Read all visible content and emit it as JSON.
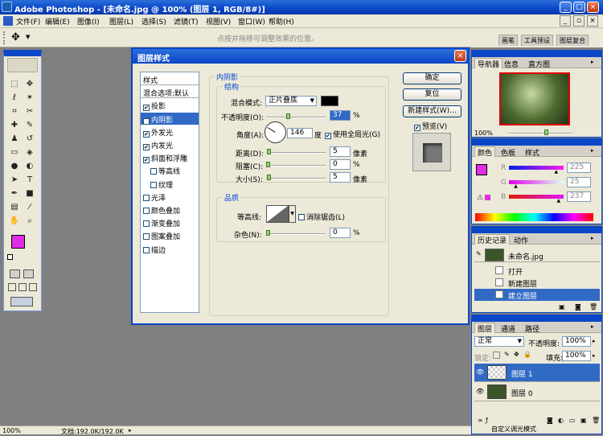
{
  "app": {
    "title": "Adobe Photoshop - [未命名.jpg @ 100% (图层 1, RGB/8#)]"
  },
  "menu": [
    "文件(F)",
    "编辑(E)",
    "图像(I)",
    "图层(L)",
    "选择(S)",
    "滤镜(T)",
    "视图(V)",
    "窗口(W)",
    "帮助(H)"
  ],
  "options": {
    "hint": "点按并拖移可调整效果的位置。"
  },
  "wells": [
    "画笔",
    "工具预设",
    "图层复合"
  ],
  "toolbox": {
    "icons": [
      "marquee-icon",
      "move-icon",
      "lasso-icon",
      "magic-wand-icon",
      "crop-icon",
      "slice-icon",
      "healing-icon",
      "brush-icon",
      "stamp-icon",
      "history-brush-icon",
      "eraser-icon",
      "bucket-icon",
      "blur-icon",
      "dodge-icon",
      "path-select-icon",
      "type-icon",
      "pen-icon",
      "shape-icon",
      "notes-icon",
      "eyedropper-icon",
      "hand-icon",
      "zoom-icon"
    ],
    "fg_color": "#e12ce6",
    "bg_color": "#ffffff"
  },
  "dialog": {
    "title": "图层样式",
    "styles": [
      {
        "label": "样式",
        "checkbox": false,
        "checked": false
      },
      {
        "label": "混合选项:默认",
        "checkbox": false,
        "checked": false
      },
      {
        "label": "投影",
        "checkbox": true,
        "checked": true
      },
      {
        "label": "内阴影",
        "checkbox": true,
        "checked": true,
        "selected": true
      },
      {
        "label": "外发光",
        "checkbox": true,
        "checked": true
      },
      {
        "label": "内发光",
        "checkbox": true,
        "checked": true
      },
      {
        "label": "斜面和浮雕",
        "checkbox": true,
        "checked": true
      },
      {
        "label": "等高线",
        "checkbox": true,
        "checked": false,
        "indent": true
      },
      {
        "label": "纹理",
        "checkbox": true,
        "checked": false,
        "indent": true
      },
      {
        "label": "光泽",
        "checkbox": true,
        "checked": false
      },
      {
        "label": "颜色叠加",
        "checkbox": true,
        "checked": false
      },
      {
        "label": "渐变叠加",
        "checkbox": true,
        "checked": false
      },
      {
        "label": "图案叠加",
        "checkbox": true,
        "checked": false
      },
      {
        "label": "描边",
        "checkbox": true,
        "checked": false
      }
    ],
    "section_title": "内阴影",
    "structure": {
      "title": "结构",
      "blend_label": "混合模式:",
      "blend_value": "正片叠底",
      "shadow_color": "#000000",
      "opacity_label": "不透明度(O):",
      "opacity_value": "37",
      "opacity_frac": 0.37,
      "angle_label": "角度(A):",
      "angle_value": "146",
      "angle_unit": "度",
      "global_light_label": "使用全局光(G)",
      "global_light": true,
      "distance_label": "距离(D):",
      "distance_value": "5",
      "distance_unit": "像素",
      "distance_frac": 0.02,
      "choke_label": "阻塞(C):",
      "choke_value": "0",
      "choke_unit": "%",
      "choke_frac": 0,
      "size_label": "大小(S):",
      "size_value": "5",
      "size_unit": "像素",
      "size_frac": 0.02
    },
    "quality": {
      "title": "品质",
      "contour_label": "等高线:",
      "antialias_label": "消除锯齿(L)",
      "antialias": false,
      "noise_label": "杂色(N):",
      "noise_value": "0",
      "noise_unit": "%",
      "noise_frac": 0
    },
    "percent": "%",
    "buttons": {
      "ok": "确定",
      "reset": "复位",
      "new_style": "新建样式(W)...",
      "preview": "预览(V)"
    },
    "preview_checked": true
  },
  "navigator": {
    "tabs": [
      "导航器",
      "信息",
      "直方图"
    ],
    "zoom": "100%"
  },
  "color": {
    "tabs": [
      "颜色",
      "色板",
      "样式"
    ],
    "channels": [
      {
        "name": "R",
        "value": "225",
        "frac": 0.882
      },
      {
        "name": "G",
        "value": "25",
        "frac": 0.098
      },
      {
        "name": "B",
        "value": "237",
        "frac": 0.929
      }
    ]
  },
  "history": {
    "tabs": [
      "历史记录",
      "动作"
    ],
    "snapshot": "未命名.jpg",
    "items": [
      "打开",
      "新建图层",
      "建立图层"
    ]
  },
  "layers": {
    "tabs": [
      "图层",
      "通道",
      "路径"
    ],
    "blend_mode": "正常",
    "opacity_label": "不透明度:",
    "opacity": "100%",
    "lock_label": "锁定:",
    "fill_label": "填充:",
    "fill": "100%",
    "items": [
      {
        "name": "图层 1",
        "selected": true
      },
      {
        "name": "图层 0",
        "selected": false
      }
    ]
  },
  "statusbar": {
    "zoom": "100%",
    "doc": "文档:192.0K/192.0K",
    "tip": "自定义调光模式"
  }
}
